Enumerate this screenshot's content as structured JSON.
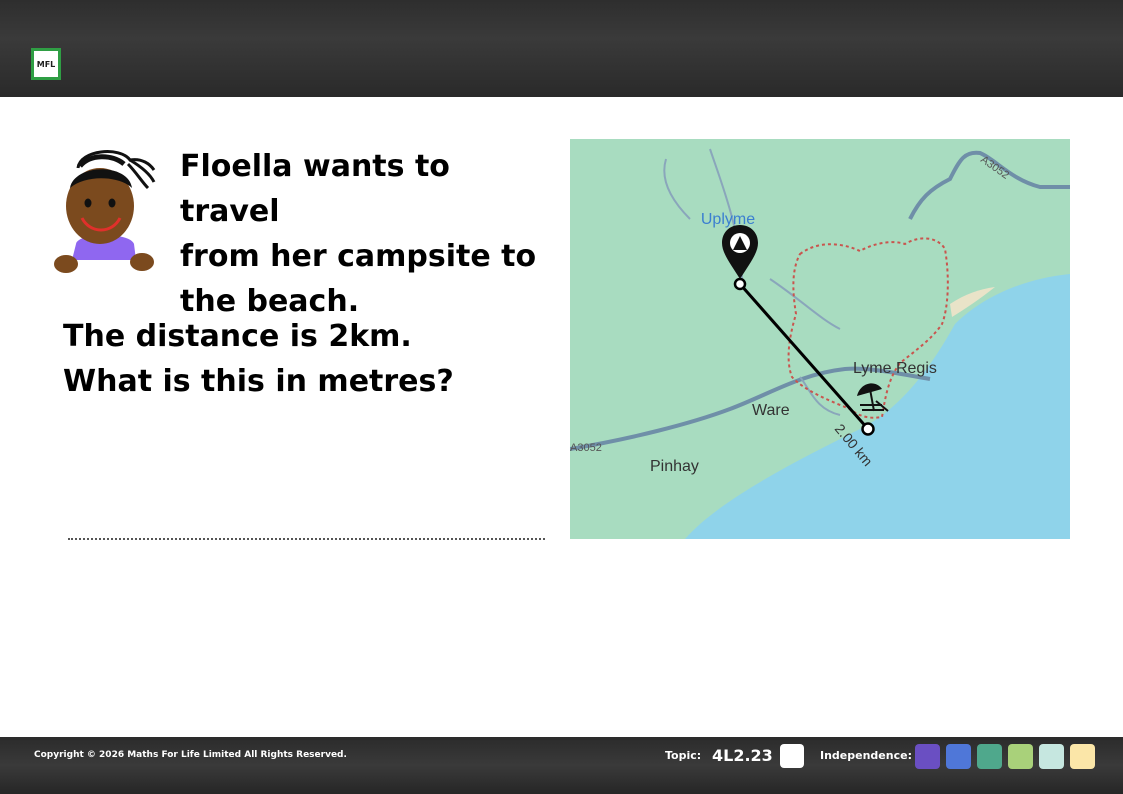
{
  "question": {
    "line1": "Floella wants to travel",
    "line2": "from her campsite to",
    "line3": "the beach."
  },
  "prompt": {
    "line1": "The distance is 2km.",
    "line2": "What is this in metres?"
  },
  "map": {
    "labels": {
      "uplyme": "Uplyme",
      "lyme_regis": "Lyme Regis",
      "ware": "Ware",
      "pinhay": "Pinhay",
      "road_a3052_left": "A3052",
      "road_a3052_right": "A3052",
      "distance": "2.00 km"
    },
    "colors": {
      "land": "#a8dcc0",
      "sea": "#8fd3ea",
      "road": "#6f8fa8"
    },
    "icons": {
      "campsite": "campsite-pin-icon",
      "beach": "beach-umbrella-icon"
    }
  },
  "footer": {
    "copyright": "Copyright © 2026 Maths For Life Limited All Rights Reserved.",
    "topic_label": "Topic:",
    "topic_code": "4L2.23",
    "independence_label": "Independence:",
    "independence_colors": [
      "#6a4fc2",
      "#4f77d8",
      "#4fa88c",
      "#a9d17a",
      "#c6e7e0",
      "#fbe6a8"
    ]
  },
  "logo": {
    "text": "MFL"
  }
}
